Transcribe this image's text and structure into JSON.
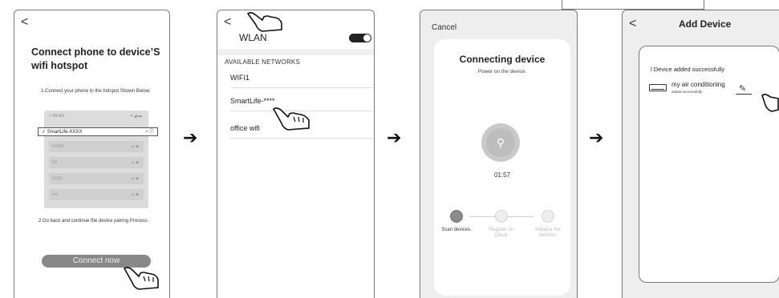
{
  "screen1": {
    "back": "<",
    "title": "Connect phone to device’S wifi hotspot",
    "step1": "1.Connect your phone to the hotspot Shown Below:",
    "mock_header": "< WLAN",
    "mock_rows": [
      "HOME",
      "5G",
      "5G(F)",
      "xxx"
    ],
    "selected_network": "✓ SmartLife-XXXX",
    "step2": "2.Go back and continue the device pairing Process:",
    "connect_button": "Connect now"
  },
  "screen2": {
    "back": "<",
    "title": "WLAN",
    "section": "AVAILABLE NETWORKS",
    "networks": [
      "WIFI1",
      "SmartLife-****",
      "office wifi"
    ]
  },
  "screen3": {
    "cancel": "Cancel",
    "title": "Connecting device",
    "subtitle": "Power on the device.",
    "timer": "01:57",
    "steps": [
      {
        "label": "Scan devices.",
        "active": true
      },
      {
        "label": "Register on Cloud.",
        "active": false
      },
      {
        "label": "Initialize the devices.",
        "active": false
      }
    ]
  },
  "screen4": {
    "back": "<",
    "title": "Add Device",
    "message": "l Device added successfully",
    "device_name": "my air conditioning",
    "device_status": "added successfully"
  },
  "arrows": [
    "➔",
    "➔",
    "➔"
  ],
  "colors": {
    "button_gray": "#888888",
    "toggle_on": "#222222",
    "step_active": "#8a8a8a"
  }
}
